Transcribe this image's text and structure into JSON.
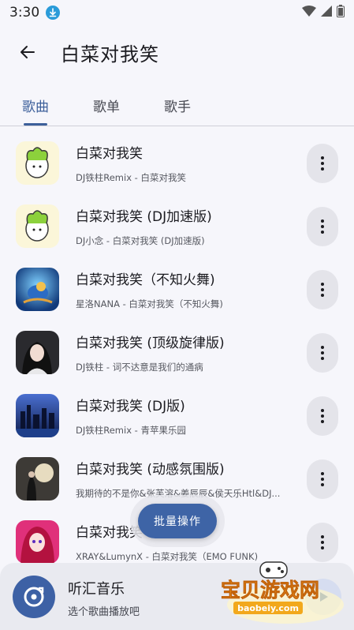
{
  "status": {
    "time": "3:30"
  },
  "header": {
    "title": "白菜对我笑"
  },
  "tabs": [
    {
      "label": "歌曲",
      "active": true
    },
    {
      "label": "歌单",
      "active": false
    },
    {
      "label": "歌手",
      "active": false
    }
  ],
  "songs": [
    {
      "title": "白菜对我笑",
      "subtitle": "DJ铁柱Remix - 白菜对我笑",
      "cover": "cabbage"
    },
    {
      "title": "白菜对我笑 (DJ加速版)",
      "subtitle": "DJ小念 - 白菜对我笑 (DJ加速版)",
      "cover": "cabbage"
    },
    {
      "title": "白菜对我笑（不知火舞)",
      "subtitle": "星洛NANA - 白菜对我笑（不知火舞)",
      "cover": "blue-bird"
    },
    {
      "title": "白菜对我笑 (顶级旋律版)",
      "subtitle": "DJ铁柱 - 词不达意是我们的通病",
      "cover": "portrait"
    },
    {
      "title": "白菜对我笑 (DJ版)",
      "subtitle": "DJ铁柱Remix - 青苹果乐园",
      "cover": "city"
    },
    {
      "title": "白菜对我笑 (动感氛围版)",
      "subtitle": "我期待的不是你&张芙溶&姜辰辰&侯天乐Htl&DJ...",
      "cover": "moon"
    },
    {
      "title": "白菜对我笑",
      "subtitle": "XRAY&LumynX - 白菜对我笑（EMO FUNK)",
      "cover": "anime"
    }
  ],
  "batch_button": {
    "label": "批量操作"
  },
  "player": {
    "app_name": "听汇音乐",
    "hint": "选个歌曲播放吧"
  },
  "watermark": {
    "text": "宝贝游戏网",
    "url": "baobeiy.com"
  },
  "colors": {
    "accent": "#3e64a6",
    "tab_active": "#3c5f9a",
    "background": "#f6f6fb"
  }
}
